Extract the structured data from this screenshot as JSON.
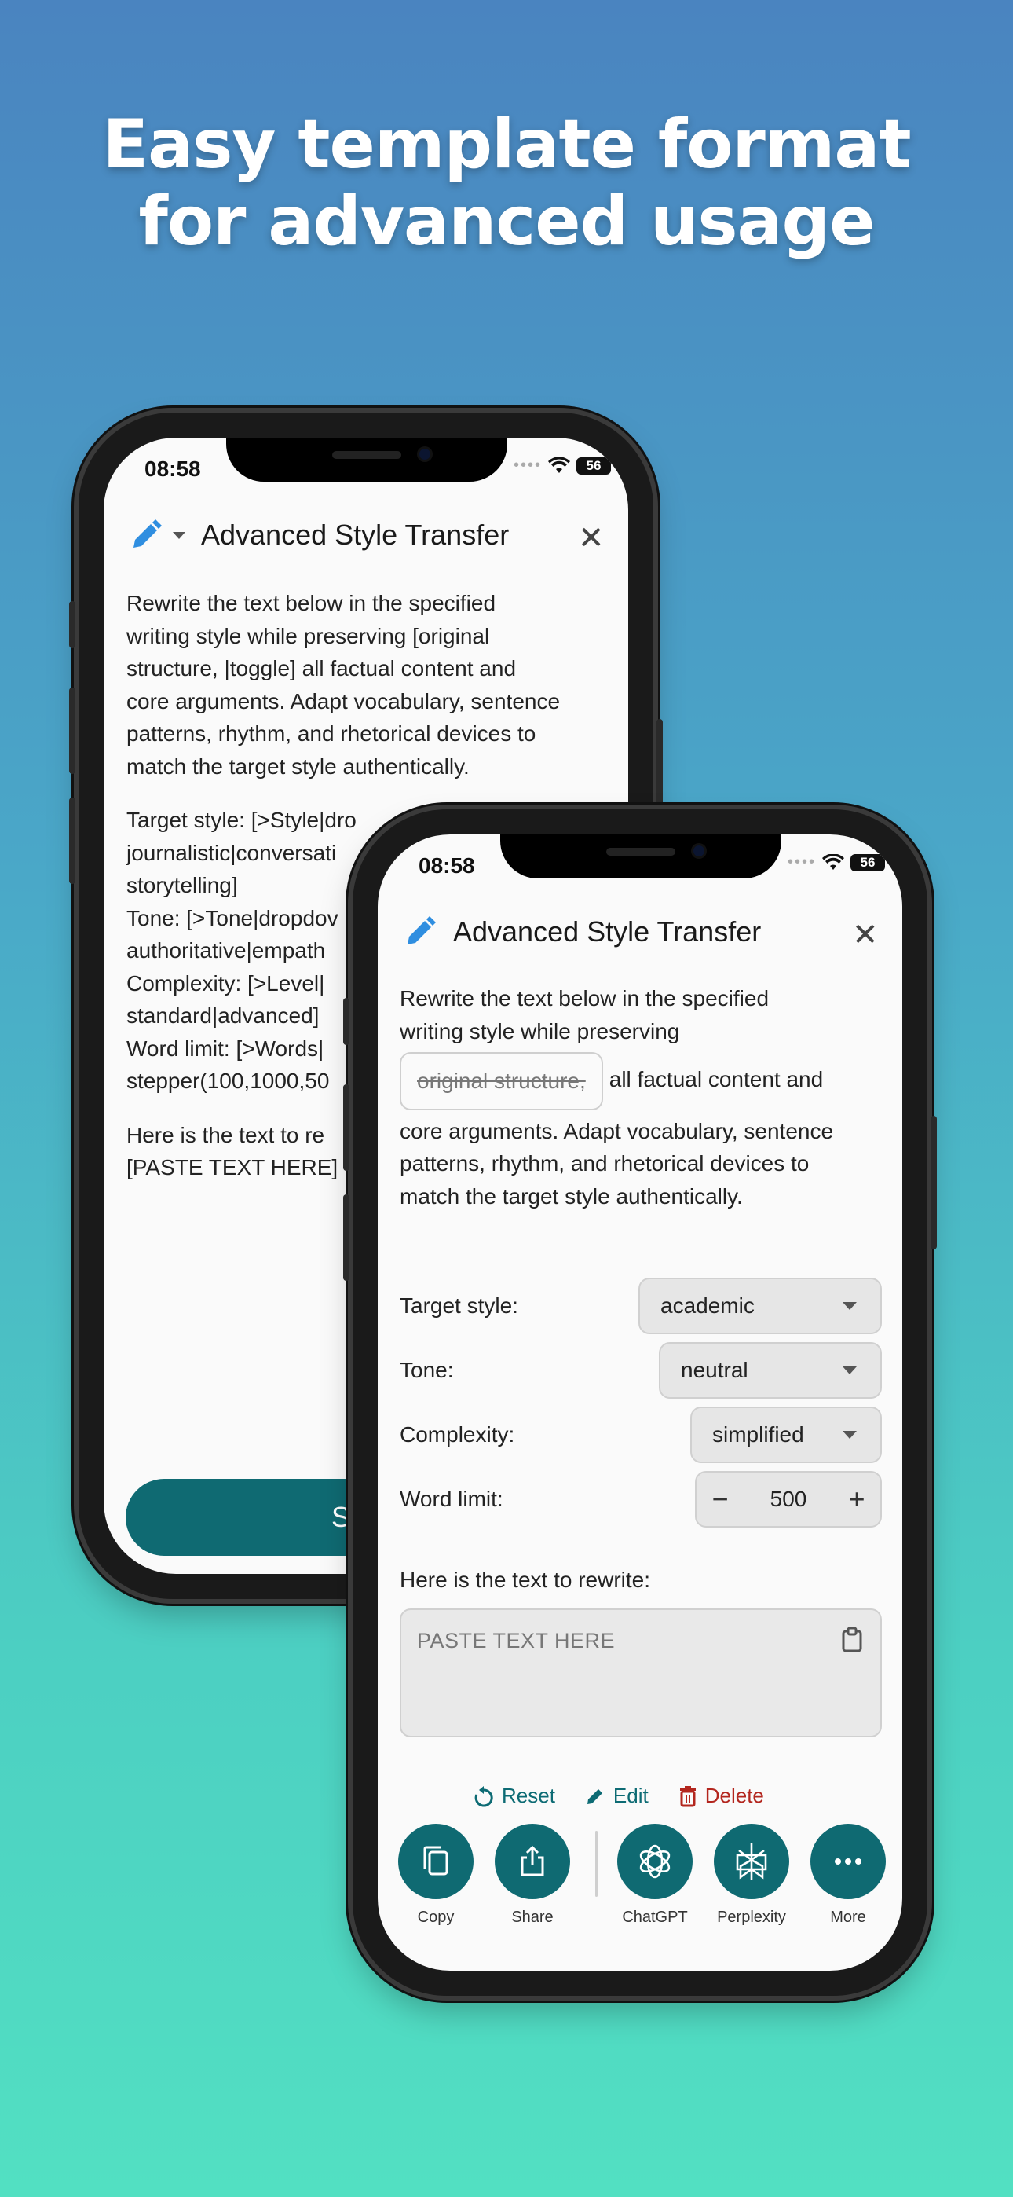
{
  "headline": {
    "line1": "Easy template format",
    "line2": "for advanced usage"
  },
  "back_phone": {
    "status_time": "08:58",
    "battery": "56",
    "app_title": "Advanced Style Transfer",
    "template_lines": [
      "Rewrite the text below in the specified",
      "writing style while preserving [original",
      "structure, |toggle] all factual content and",
      "core arguments. Adapt vocabulary, sentence",
      "patterns, rhythm, and rhetorical devices to",
      "match the target style authentically.",
      "",
      "Target style: [>Style|dro",
      "journalistic|conversati",
      "storytelling]",
      "Tone: [>Tone|dropdov",
      "authoritative|empath",
      "Complexity: [>Level|",
      "standard|advanced]",
      "Word limit: [>Words|",
      "stepper(100,1000,50",
      "",
      "Here is the text to re",
      "[PASTE TEXT HERE]"
    ],
    "bottom_button_label": "S"
  },
  "front_phone": {
    "status_time": "08:58",
    "battery": "56",
    "app_title": "Advanced Style Transfer",
    "intro_line1": "Rewrite the text below in the specified",
    "intro_line2": "writing style while preserving",
    "toggle_chip": "original structure,",
    "intro_line3_after_chip": "all factual content and",
    "intro_line4": "core arguments. Adapt vocabulary, sentence",
    "intro_line5": "patterns, rhythm, and rhetorical devices to",
    "intro_line6": "match the target style authentically.",
    "fields": {
      "target_style": {
        "label": "Target style:",
        "value": "academic"
      },
      "tone": {
        "label": "Tone:",
        "value": "neutral"
      },
      "complexity": {
        "label": "Complexity:",
        "value": "simplified"
      },
      "word_limit": {
        "label": "Word limit:",
        "value": "500",
        "minus": "−",
        "plus": "+"
      }
    },
    "paste_prompt": "Here is the text to rewrite:",
    "paste_placeholder": "PASTE TEXT HERE",
    "actions": {
      "reset": "Reset",
      "edit": "Edit",
      "delete": "Delete"
    },
    "buttons": [
      {
        "label": "Copy",
        "icon": "copy-icon"
      },
      {
        "label": "Share",
        "icon": "share-icon"
      },
      {
        "label": "ChatGPT",
        "icon": "chatgpt-icon"
      },
      {
        "label": "Perplexity",
        "icon": "perplexity-icon"
      },
      {
        "label": "More",
        "icon": "more-icon"
      }
    ]
  },
  "colors": {
    "accent": "#0f6a72",
    "danger": "#b3261e",
    "pen": "#2f8ee0"
  }
}
